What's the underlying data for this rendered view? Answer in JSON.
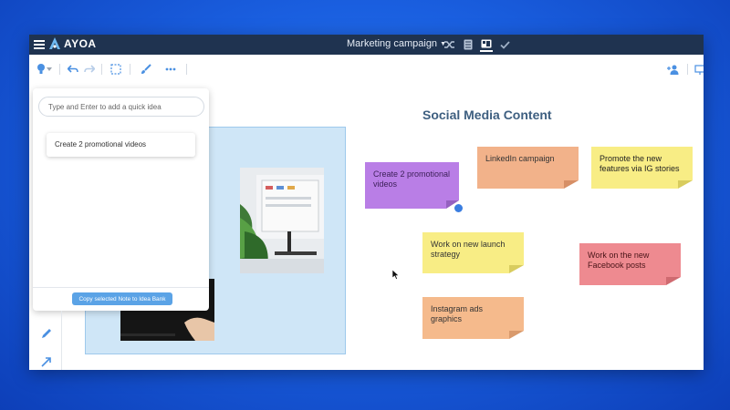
{
  "app": {
    "brand": "AYOA",
    "title": "Marketing campaign"
  },
  "topbar_icons": [
    "shuffle-icon",
    "list-view-icon",
    "board-view-icon",
    "check-icon"
  ],
  "toolbar": {
    "tools": [
      "bulb-icon",
      "undo-icon",
      "redo-icon",
      "select-icon",
      "paint-brush-icon",
      "more-icon",
      "add-user-icon",
      "present-icon"
    ]
  },
  "quick_idea": {
    "placeholder": "Type and Enter to add a quick idea",
    "ideas": [
      "Create 2 promotional videos"
    ],
    "copy_button": "Copy selected Note to Idea Bank"
  },
  "canvas": {
    "section_title": "Social Media Content",
    "notes": [
      {
        "text": "Create 2 promotional videos",
        "color": "#b97ee6"
      },
      {
        "text": "LinkedIn campaign",
        "color": "#f2b28a"
      },
      {
        "text": "Promote the new features via IG stories",
        "color": "#f8ed85"
      },
      {
        "text": "Work on new launch strategy",
        "color": "#f8ed85"
      },
      {
        "text": "Work on the new Facebook posts",
        "color": "#ee8a90"
      },
      {
        "text": "Instagram ads graphics",
        "color": "#f5ba8c"
      }
    ]
  },
  "left_tools": [
    "pencil-icon",
    "arrow-icon"
  ],
  "colors": {
    "topbar": "#1f3350",
    "accent": "#3a7de0",
    "background": "#1a5fe0"
  }
}
